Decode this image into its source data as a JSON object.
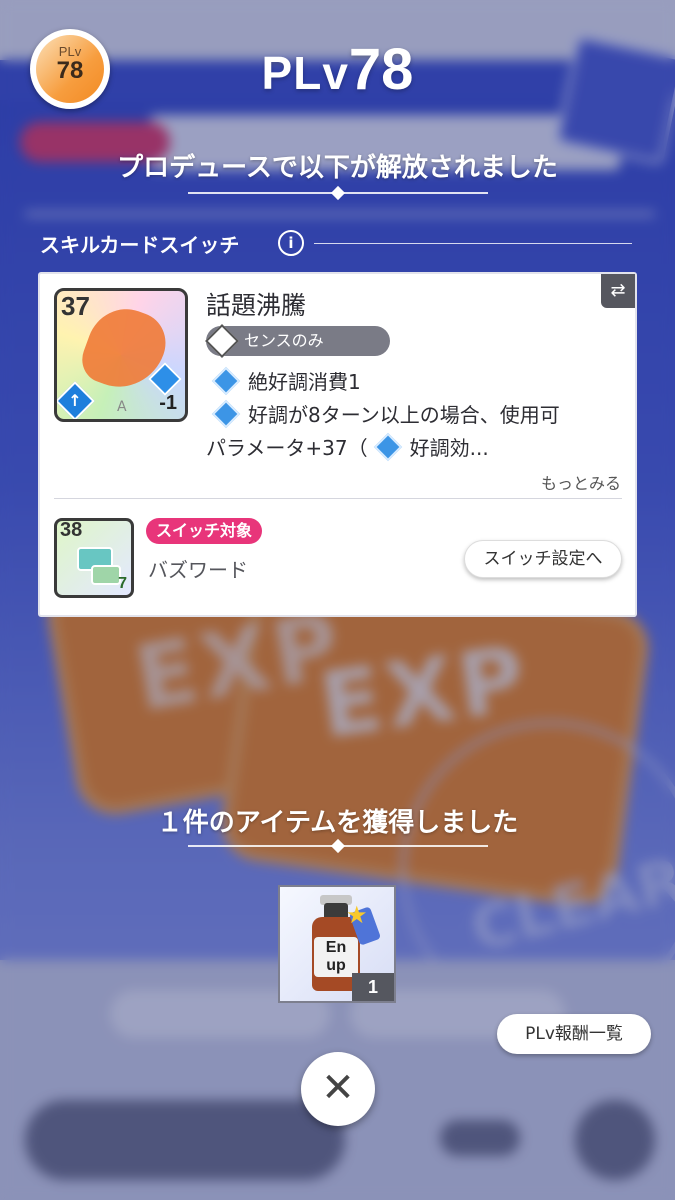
{
  "header": {
    "badge_label": "PLv",
    "badge_value": "78",
    "title_prefix": "PLv",
    "title_value": "78"
  },
  "unlock_heading": "プロデュースで以下が解放されました",
  "section": {
    "title": "スキルカードスイッチ",
    "info_icon": "info-icon"
  },
  "card": {
    "cost": "37",
    "rank": "A",
    "modifier": "-1",
    "name": "話題沸騰",
    "type": "センスのみ",
    "effects": [
      "絶好調消費1",
      "好調が8ターン以上の場合、使用可",
      "パラメータ+37（"
    ],
    "effect3_tail": "好調効...",
    "more_link": "もっとみる"
  },
  "switch_card": {
    "cost": "38",
    "badge_num": "7",
    "tag": "スイッチ対象",
    "name": "バズワード",
    "settings_button": "スイッチ設定へ"
  },
  "items_heading": "１件のアイテムを獲得しました",
  "item": {
    "label_line1": "En",
    "label_line2": "up",
    "quantity": "1"
  },
  "buttons": {
    "rewards_list": "PLv報酬一覧",
    "close_icon": "close-icon"
  },
  "background": {
    "exp_text": "EXP",
    "clear_text": "CLEAR"
  },
  "colors": {
    "accent_pink": "#e8357a",
    "sense_blue": "#3c95e6",
    "badge_orange": "#f28a23"
  }
}
